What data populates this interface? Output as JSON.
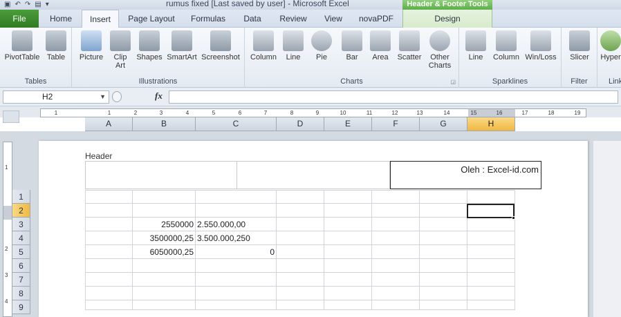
{
  "window": {
    "title": "rumus fixed [Last saved by user]  -  Microsoft Excel",
    "context_tool_title": "Header & Footer Tools"
  },
  "tabs": {
    "file": "File",
    "home": "Home",
    "insert": "Insert",
    "page_layout": "Page Layout",
    "formulas": "Formulas",
    "data": "Data",
    "review": "Review",
    "view": "View",
    "novapdf": "novaPDF",
    "design": "Design"
  },
  "ribbon": {
    "groups": {
      "tables": "Tables",
      "illustrations": "Illustrations",
      "charts": "Charts",
      "sparklines": "Sparklines",
      "filter": "Filter",
      "links": "Link"
    },
    "buttons": {
      "pivottable": "PivotTable",
      "table": "Table",
      "picture": "Picture",
      "clip_art_1": "Clip",
      "clip_art_2": "Art",
      "shapes": "Shapes",
      "smartart": "SmartArt",
      "screenshot": "Screenshot",
      "column": "Column",
      "line": "Line",
      "pie": "Pie",
      "bar": "Bar",
      "area": "Area",
      "scatter": "Scatter",
      "other_charts_1": "Other",
      "other_charts_2": "Charts",
      "spark_line": "Line",
      "spark_column": "Column",
      "spark_winloss": "Win/Loss",
      "slicer": "Slicer",
      "hyperlink": "Hyper"
    }
  },
  "formula_bar": {
    "name_box": "H2",
    "fx": "fx",
    "formula": ""
  },
  "ruler": {
    "ticks": [
      "1",
      "1",
      "2",
      "3",
      "4",
      "5",
      "6",
      "7",
      "8",
      "9",
      "10",
      "11",
      "12",
      "13",
      "14",
      "15",
      "16",
      "17",
      "18",
      "19"
    ]
  },
  "vertical_ruler": {
    "ticks": [
      "1",
      "2",
      "3",
      "4"
    ]
  },
  "columns": [
    "A",
    "B",
    "C",
    "D",
    "E",
    "F",
    "G",
    "H"
  ],
  "selected_column": "H",
  "header_area": {
    "label": "Header",
    "right_text": "Oleh : Excel-id.com"
  },
  "rows": [
    {
      "num": "1",
      "b": "",
      "c": ""
    },
    {
      "num": "2",
      "b": "",
      "c": ""
    },
    {
      "num": "3",
      "b": "2550000",
      "c": "2.550.000,00"
    },
    {
      "num": "4",
      "b": "3500000,25",
      "c": "3.500.000,250"
    },
    {
      "num": "5",
      "b": "6050000,25",
      "c": "0"
    },
    {
      "num": "6",
      "b": "",
      "c": ""
    },
    {
      "num": "7",
      "b": "",
      "c": ""
    },
    {
      "num": "8",
      "b": "",
      "c": ""
    },
    {
      "num": "9",
      "b": "",
      "c": ""
    }
  ],
  "selected_row": "2"
}
